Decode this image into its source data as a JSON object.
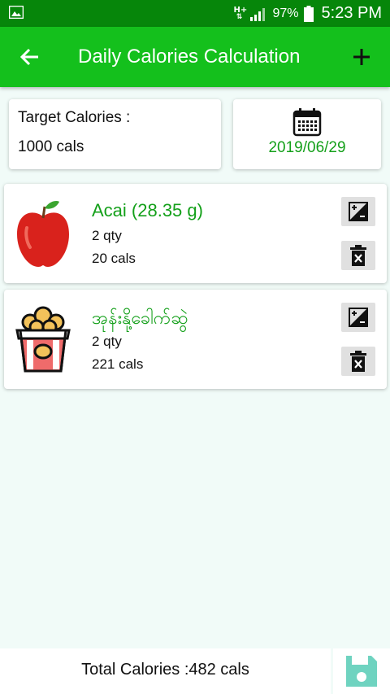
{
  "status_bar": {
    "network_type": "H+",
    "battery_percent": "97%",
    "time": "5:23 PM"
  },
  "app_bar": {
    "title": "Daily Calories Calculation"
  },
  "target": {
    "label": "Target Calories :",
    "value": "1000 cals"
  },
  "date": {
    "value": "2019/06/29"
  },
  "foods": [
    {
      "name": "Acai (28.35 g)",
      "qty": "2 qty",
      "cals": "20 cals",
      "icon": "apple-icon"
    },
    {
      "name": "အုန်းနို့ခေါက်ဆွဲ",
      "qty": "2 qty",
      "cals": "221 cals",
      "icon": "popcorn-icon"
    }
  ],
  "total": {
    "label": "Total Calories :482 cals"
  },
  "colors": {
    "status_bar": "#06860a",
    "app_bar": "#14c01c",
    "accent_text": "#14a01a",
    "save_icon": "#6fd3c0"
  }
}
